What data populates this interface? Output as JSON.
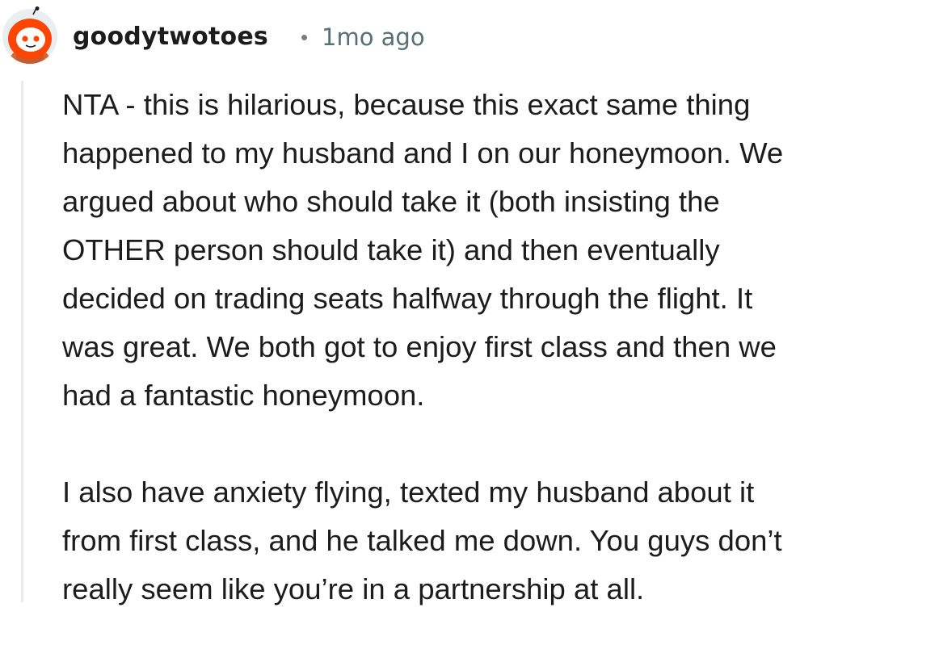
{
  "comment": {
    "username": "goodytwotoes",
    "separator": "•",
    "timestamp": "1mo ago",
    "paragraphs": [
      {
        "lines": [
          "NTA - this is hilarious, because this exact same thing",
          "happened to my husband and I on our honeymoon. We",
          "argued about who should take it (both insisting the",
          "OTHER person should take it) and then eventually",
          "decided on trading seats halfway through the flight. It",
          "was great. We both got to enjoy first class and then we",
          "had a fantastic honeymoon."
        ]
      },
      {
        "lines": [
          "I also have anxiety flying, texted my husband about it",
          "from first class, and he talked me down. You guys don’t",
          "really seem like you’re in a partnership at all."
        ]
      }
    ]
  },
  "colors": {
    "username": "#1c1c1c",
    "timestamp": "#576f76",
    "body_text": "#1c1c1c",
    "thread_line": "#e5ebee",
    "avatar_accent": "#ff4500"
  },
  "icons": {
    "avatar": "snoo-avatar-icon"
  }
}
